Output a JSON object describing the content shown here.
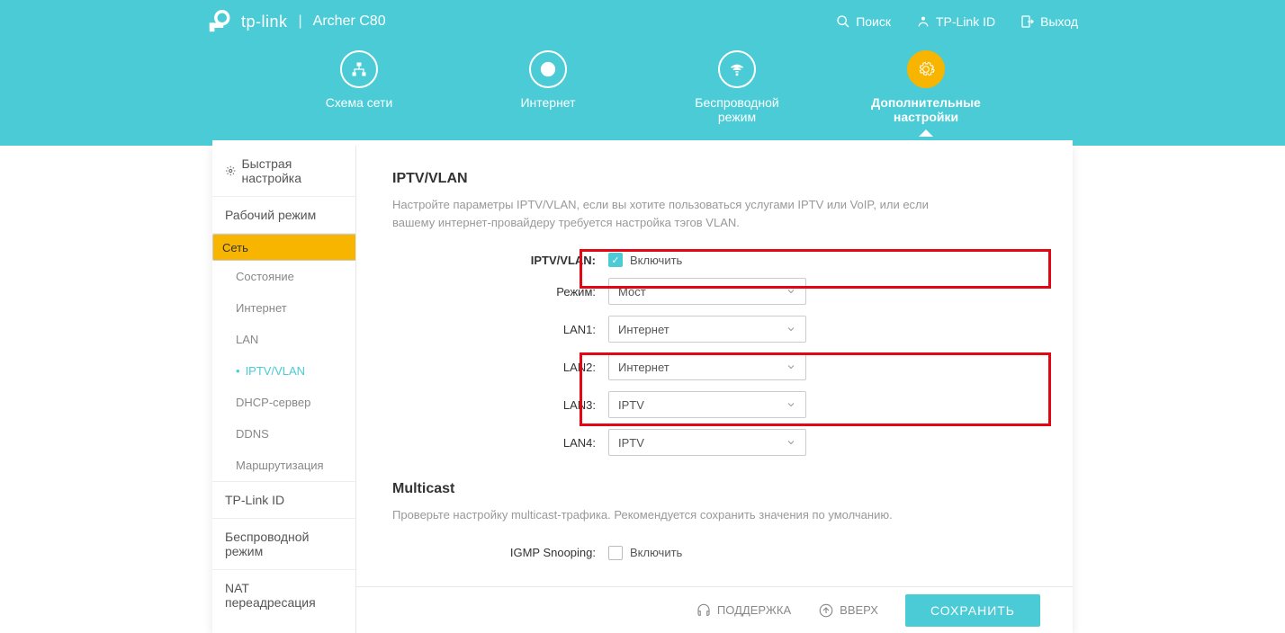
{
  "header": {
    "brand": "tp-link",
    "model": "Archer C80",
    "search": "Поиск",
    "tplink_id": "TP-Link ID",
    "logout": "Выход"
  },
  "nav": {
    "items": [
      {
        "label": "Схема сети"
      },
      {
        "label": "Интернет"
      },
      {
        "label": "Беспроводной режим"
      },
      {
        "label": "Дополнительные настройки"
      }
    ]
  },
  "sidebar": {
    "quick": "Быстрая настройка",
    "mode": "Рабочий режим",
    "net": "Сеть",
    "subs": [
      "Состояние",
      "Интернет",
      "LAN",
      "IPTV/VLAN",
      "DHCP-сервер",
      "DDNS",
      "Маршрутизация"
    ],
    "tplink": "TP-Link ID",
    "wireless": "Беспроводной режим",
    "nat": "NAT переадресация"
  },
  "iptv": {
    "title": "IPTV/VLAN",
    "desc": "Настройте параметры IPTV/VLAN, если вы хотите пользоваться услугами IPTV или VoIP, или если вашему интернет-провайдеру требуется настройка тэгов VLAN.",
    "enable_label": "IPTV/VLAN:",
    "enable_chk": "Включить",
    "mode_label": "Режим:",
    "mode_val": "Мост",
    "lan1_label": "LAN1:",
    "lan1_val": "Интернет",
    "lan2_label": "LAN2:",
    "lan2_val": "Интернет",
    "lan3_label": "LAN3:",
    "lan3_val": "IPTV",
    "lan4_label": "LAN4:",
    "lan4_val": "IPTV"
  },
  "multicast": {
    "title": "Multicast",
    "desc": "Проверьте настройку multicast-трафика. Рекомендуется сохранить значения по умолчанию.",
    "igmp_label": "IGMP Snooping:",
    "igmp_chk": "Включить"
  },
  "footer": {
    "support": "ПОДДЕРЖКА",
    "up": "ВВЕРХ",
    "save": "СОХРАНИТЬ"
  }
}
